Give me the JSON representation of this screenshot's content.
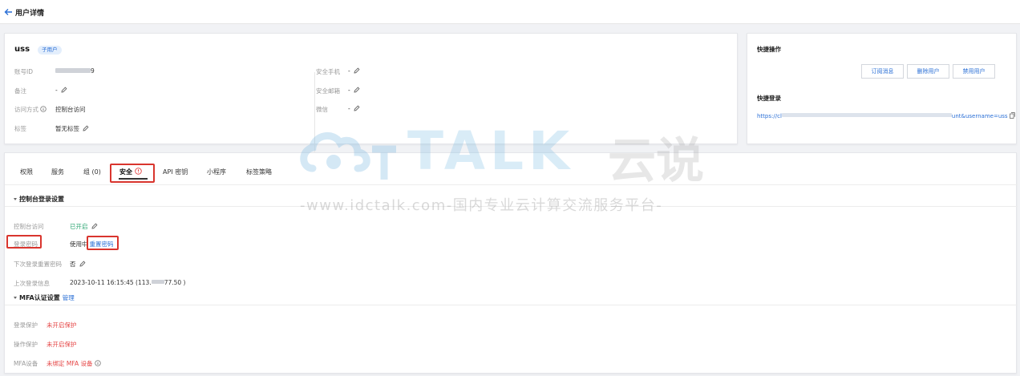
{
  "header": {
    "title": "用户详情"
  },
  "user": {
    "name": "uss",
    "badge": "子用户",
    "fields_left": [
      {
        "label": "账号ID",
        "value": "9"
      },
      {
        "label": "备注",
        "value": "-"
      },
      {
        "label": "访问方式",
        "value": "控制台访问"
      },
      {
        "label": "标签",
        "value": "暂无标签"
      }
    ],
    "fields_right": [
      {
        "label": "安全手机",
        "value": "-"
      },
      {
        "label": "安全邮箱",
        "value": "-"
      },
      {
        "label": "微信",
        "value": "-"
      }
    ]
  },
  "quick": {
    "actions_title": "快捷操作",
    "buttons": [
      "订阅消息",
      "删除用户",
      "禁用用户"
    ],
    "login_title": "快捷登录",
    "login_url_start": "https://cl",
    "login_url_end": "unt&username=uss"
  },
  "tabs": [
    {
      "label": "权限"
    },
    {
      "label": "服务"
    },
    {
      "label": "组 (0)"
    },
    {
      "label": "安全"
    },
    {
      "label": "API 密钥"
    },
    {
      "label": "小程序"
    },
    {
      "label": "标签策略"
    }
  ],
  "security": {
    "console_section_title": "控制台登录设置",
    "console_access_label": "控制台访问",
    "console_access_value": "已开启",
    "login_password_label": "登录密码",
    "login_password_prefix": "使用中",
    "login_password_link": "重置密码",
    "next_login_reset_label": "下次登录重置密码",
    "next_login_reset_value": "否",
    "last_login_label": "上次登录信息",
    "last_login_time": "2023-10-11 16:15:45",
    "last_login_ip_start": "(113.",
    "last_login_ip_end": "77.50 )",
    "mfa_section_title": "MFA认证设置",
    "mfa_manage_link": "管理",
    "login_protect_label": "登录保护",
    "login_protect_value": "未开启保护",
    "op_protect_label": "操作保护",
    "op_protect_value": "未开启保护",
    "mfa_device_label": "MFA设备",
    "mfa_device_value": "未绑定 MFA 设备"
  },
  "watermark": {
    "brand": "TALK",
    "brand_cn": "云说",
    "subtitle": "-www.idctalk.com-国内专业云计算交流服务平台-"
  },
  "colors": {
    "accent": "#2a6fd6",
    "success": "#2ba471",
    "danger": "#e54545",
    "highlight_box": "#d9352e"
  }
}
